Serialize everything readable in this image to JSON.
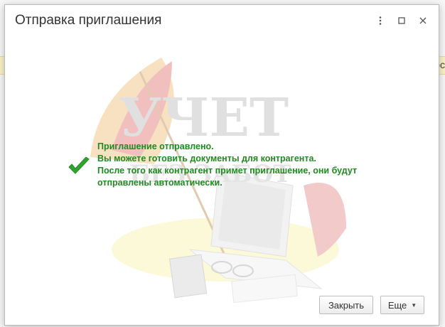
{
  "background": {
    "strip_text": "ос"
  },
  "dialog": {
    "title": "Отправка приглашения",
    "controls": {
      "more_icon": "more-vert-icon",
      "maximize_icon": "maximize-icon",
      "close_icon": "close-icon"
    }
  },
  "message": {
    "icon": "checkmark-icon",
    "lines": [
      "Приглашение отправлено.",
      "Вы можете готовить документы для контрагента.",
      "После того как контрагент примет приглашение, они будут",
      "отправлены автоматически."
    ],
    "color": "#1f8a1f"
  },
  "watermark": {
    "line1": "УЧЕТ",
    "line2": "БЕЗ ЗАБОТ"
  },
  "buttons": {
    "close_label": "Закрыть",
    "more_label": "Еще"
  }
}
